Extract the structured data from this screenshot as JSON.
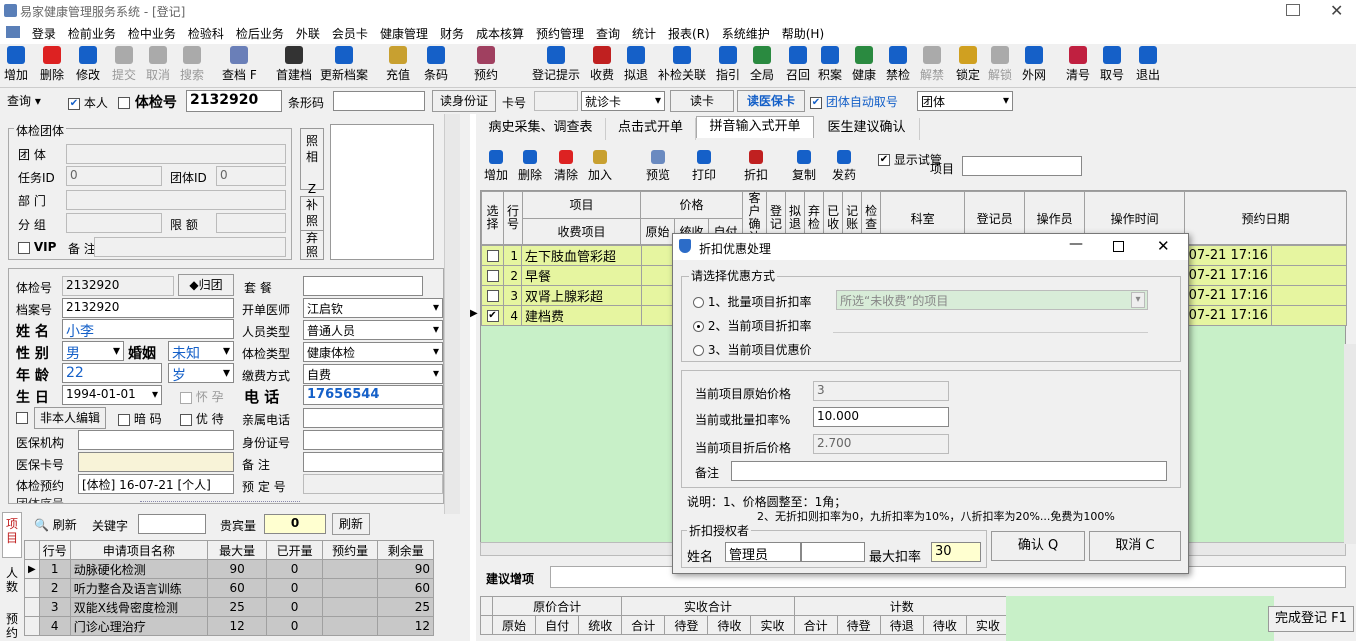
{
  "window": {
    "title": "易家健康管理服务系统 - [登记]"
  },
  "menu": [
    "登录",
    "检前业务",
    "检中业务",
    "检验科",
    "检后业务",
    "外联",
    "会员卡",
    "健康管理",
    "财务",
    "成本核算",
    "预约管理",
    "查询",
    "统计",
    "报表(R)",
    "系统维护",
    "帮助(H)"
  ],
  "toolbar": [
    {
      "label": "增加",
      "icon": "add-icon",
      "color": "#1560c8",
      "enabled": true
    },
    {
      "label": "删除",
      "icon": "delete-icon",
      "color": "#d22",
      "enabled": true
    },
    {
      "label": "修改",
      "icon": "edit-icon",
      "color": "#1560c8",
      "enabled": true
    },
    {
      "label": "提交",
      "icon": "submit-icon",
      "color": "#aaa",
      "enabled": false
    },
    {
      "label": "取消",
      "icon": "cancel-icon",
      "color": "#aaa",
      "enabled": false
    },
    {
      "label": "搜索",
      "icon": "search-icon",
      "color": "#aaa",
      "enabled": false
    },
    {
      "label": "查档 F",
      "icon": "find-icon",
      "color": "#6a7fb8",
      "enabled": true
    },
    {
      "label": "首建档",
      "icon": "new-file-icon",
      "color": "#333",
      "enabled": true
    },
    {
      "label": "更新档案",
      "icon": "update-file-icon",
      "color": "#1560c8",
      "enabled": true
    },
    {
      "label": "充值",
      "icon": "recharge-icon",
      "color": "#c8a030",
      "enabled": true
    },
    {
      "label": "条码",
      "icon": "barcode-icon",
      "color": "#1560c8",
      "enabled": true
    },
    {
      "label": "预约",
      "icon": "appointment-icon",
      "color": "#a04060",
      "enabled": true
    },
    {
      "label": "登记提示",
      "icon": "register-tip-icon",
      "color": "#1560c8",
      "enabled": true
    },
    {
      "label": "收费",
      "icon": "charge-icon",
      "color": "#c02020",
      "enabled": true
    },
    {
      "label": "拟退",
      "icon": "refund-icon",
      "color": "#1560c8",
      "enabled": true
    },
    {
      "label": "补检关联",
      "icon": "link-icon",
      "color": "#1560c8",
      "enabled": true
    },
    {
      "label": "指引",
      "icon": "guide-icon",
      "color": "#1560c8",
      "enabled": true
    },
    {
      "label": "全局",
      "icon": "globe-icon",
      "color": "#2a8a40",
      "enabled": true
    },
    {
      "label": "召回",
      "icon": "recall-icon",
      "color": "#1560c8",
      "enabled": true
    },
    {
      "label": "积案",
      "icon": "backlog-icon",
      "color": "#1560c8",
      "enabled": true
    },
    {
      "label": "健康",
      "icon": "health-icon",
      "color": "#2a8a40",
      "enabled": true
    },
    {
      "label": "禁检",
      "icon": "ban-icon",
      "color": "#1560c8",
      "enabled": true
    },
    {
      "label": "解禁",
      "icon": "unban-icon",
      "color": "#aaa",
      "enabled": false
    },
    {
      "label": "锁定",
      "icon": "lock-icon",
      "color": "#d0a020",
      "enabled": true
    },
    {
      "label": "解锁",
      "icon": "unlock-icon",
      "color": "#aaa",
      "enabled": false
    },
    {
      "label": "外网",
      "icon": "network-icon",
      "color": "#1560c8",
      "enabled": true
    },
    {
      "label": "清号",
      "icon": "clear-number-icon",
      "color": "#c02040",
      "enabled": true
    },
    {
      "label": "取号",
      "icon": "take-number-icon",
      "color": "#1560c8",
      "enabled": true
    },
    {
      "label": "退出",
      "icon": "exit-icon",
      "color": "#1560c8",
      "enabled": true
    }
  ],
  "search": {
    "mode": "查询",
    "self_label": "本人",
    "exam_no_label": "体检号",
    "exam_no": "2132920",
    "barcode_label": "条形码",
    "barcode": "",
    "read_id": "读身份证",
    "card_label": "卡号",
    "card_no": "",
    "card_type": "就诊卡",
    "read_card": "读卡",
    "read_medical": "读医保卡",
    "auto_group_label": "团体自动取号",
    "auto_group_value": "团体"
  },
  "group": {
    "title": "体检团体",
    "group_label": "团 体",
    "task_label": "任务ID",
    "task_id": "0",
    "group_id_label": "团体ID",
    "group_id": "0",
    "dept_label": "部 门",
    "team_label": "分 组",
    "limit_label": "限 额",
    "vip_label": "VIP",
    "remark_label": "备 注",
    "side": [
      "照相",
      "Z",
      "补照",
      "弃照"
    ]
  },
  "patient": {
    "exam_no_label": "体检号",
    "exam_no": "2132920",
    "return_btn": "◆归团",
    "package_label": "套 餐",
    "package": "",
    "file_label": "档案号",
    "file_no": "2132920",
    "doctor_label": "开单医师",
    "doctor": "江启钦",
    "name_label": "姓 名",
    "name": "小李",
    "person_type_label": "人员类型",
    "person_type": "普通人员",
    "sex_label": "性 别",
    "sex": "男",
    "marriage_label": "婚姻",
    "marriage": "未知",
    "exam_type_label": "体检类型",
    "exam_type": "健康体检",
    "age_label": "年 龄",
    "age": "22",
    "age_unit": "岁",
    "pay_label": "缴费方式",
    "pay": "自费",
    "birth_label": "生 日",
    "birth": "1994-01-01",
    "pregnant_label": "怀 孕",
    "phone_label": "电 话",
    "phone": "17656544",
    "nonself_btn": "非本人编辑",
    "code_label": "暗 码",
    "priority_label": "优 待",
    "relative_phone_label": "亲属电话",
    "insurer_label": "医保机构",
    "idcard_label": "身份证号",
    "insurance_card_label": "医保卡号",
    "remark_label": "备 注",
    "appointment_label": "体检预约",
    "appointment": "[体检] 16-07-21 [个人]",
    "reserve_label": "预 定 号",
    "hidden_row": "团体序号"
  },
  "quota": {
    "refresh": "刷新",
    "keyword_label": "关键字",
    "vip_label": "贵宾量",
    "vip_value": "0",
    "refresh2": "刷新",
    "headers": [
      "行号",
      "申请项目名称",
      "最大量",
      "已开量",
      "预约量",
      "剩余量"
    ],
    "rows": [
      [
        "1",
        "动脉硬化检测",
        "90",
        "0",
        "",
        "90"
      ],
      [
        "2",
        "听力整合及语言训练",
        "60",
        "0",
        "",
        "60"
      ],
      [
        "3",
        "双能X线骨密度检测",
        "25",
        "0",
        "",
        "25"
      ],
      [
        "4",
        "门诊心理治疗",
        "12",
        "0",
        "",
        "12"
      ]
    ],
    "vtabs": [
      "项目",
      "人数",
      "预约"
    ]
  },
  "tabs": [
    "病史采集、调查表",
    "点击式开单",
    "拼音输入式开单",
    "医生建议确认"
  ],
  "items_toolbar": [
    "增加",
    "删除",
    "清除",
    "加入",
    "预览",
    "打印",
    "折扣",
    "复制",
    "发药"
  ],
  "items_toolbar_extra": {
    "show_trial": "显示试管",
    "item_label": "项目"
  },
  "items_table": {
    "headers": [
      "选择",
      "行号",
      "项目",
      "价格",
      "客户确认",
      "登记",
      "拟退",
      "弃检",
      "已收",
      "记账",
      "检查",
      "科室",
      "登记员",
      "操作员",
      "操作时间",
      "预约日期"
    ],
    "sub_headers": [
      "收费项目",
      "原始",
      "统收",
      "自付"
    ],
    "rows": [
      {
        "checked": false,
        "no": "1",
        "name": "左下肢血管彩超",
        "time": "-07-21 17:16"
      },
      {
        "checked": false,
        "no": "2",
        "name": "早餐",
        "time": "-07-21 17:16"
      },
      {
        "checked": false,
        "no": "3",
        "name": "双肾上腺彩超",
        "time": "-07-21 17:16"
      },
      {
        "checked": true,
        "no": "4",
        "name": "建档费",
        "time": "-07-21 17:16"
      }
    ]
  },
  "suggest": {
    "label": "建议增项",
    "summary_headers": [
      "原价合计",
      "实收合计",
      "计数"
    ],
    "summary_sub": [
      "原始",
      "自付",
      "统收",
      "合计",
      "待登",
      "待收",
      "实收",
      "合计",
      "待登",
      "待退",
      "待收",
      "实收"
    ],
    "finish": "完成登记 F1"
  },
  "dialog": {
    "title": "折扣优惠处理",
    "group_title": "请选择优惠方式",
    "opt1": "1、批量项目折扣率",
    "opt1_value": "所选“未收费”的项目",
    "opt2": "2、当前项目折扣率",
    "opt3": "3、当前项目优惠价",
    "orig_label": "当前项目原始价格",
    "orig_value": "3",
    "rate_label": "当前或批量扣率%",
    "rate_value": "10.000",
    "after_label": "当前项目折后价格",
    "after_value": "2.700",
    "remark_label": "备注",
    "note1": "说明：1、价格圆整至：1角；",
    "note2": "2、无折扣则扣率为0，九折扣率为10%，八折扣率为20%...免费为100%",
    "auth_title": "折扣授权者",
    "name_label": "姓名",
    "name_value": "管理员",
    "max_label": "最大扣率",
    "max_value": "30",
    "ok": "确认 Q",
    "cancel": "取消 C"
  }
}
